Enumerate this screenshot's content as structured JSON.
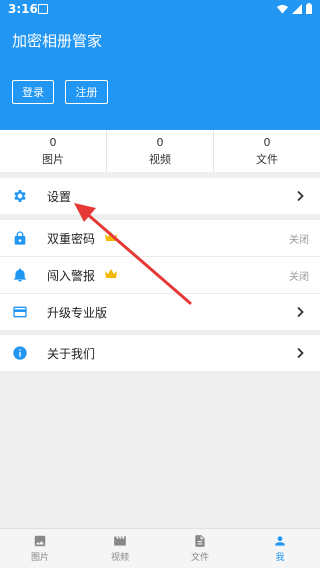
{
  "status_bar": {
    "time": "3:16"
  },
  "app": {
    "title": "加密相册管家",
    "accent": "#2196f3"
  },
  "header": {
    "login_label": "登录",
    "register_label": "注册"
  },
  "stats": [
    {
      "count": "0",
      "label": "图片"
    },
    {
      "count": "0",
      "label": "视频"
    },
    {
      "count": "0",
      "label": "文件"
    }
  ],
  "menu": {
    "settings": "设置",
    "double_password": {
      "label": "双重密码",
      "status": "关闭"
    },
    "intrusion_alert": {
      "label": "闯入警报",
      "status": "关闭"
    },
    "upgrade": "升级专业版",
    "about": "关于我们"
  },
  "bottom_nav": [
    {
      "label": "图片",
      "icon": "image-icon"
    },
    {
      "label": "视频",
      "icon": "clapperboard-icon"
    },
    {
      "label": "文件",
      "icon": "document-icon"
    },
    {
      "label": "我",
      "icon": "person-icon",
      "active": true
    }
  ],
  "colors": {
    "crown": "#f5b800",
    "arrow": "#e53935"
  }
}
